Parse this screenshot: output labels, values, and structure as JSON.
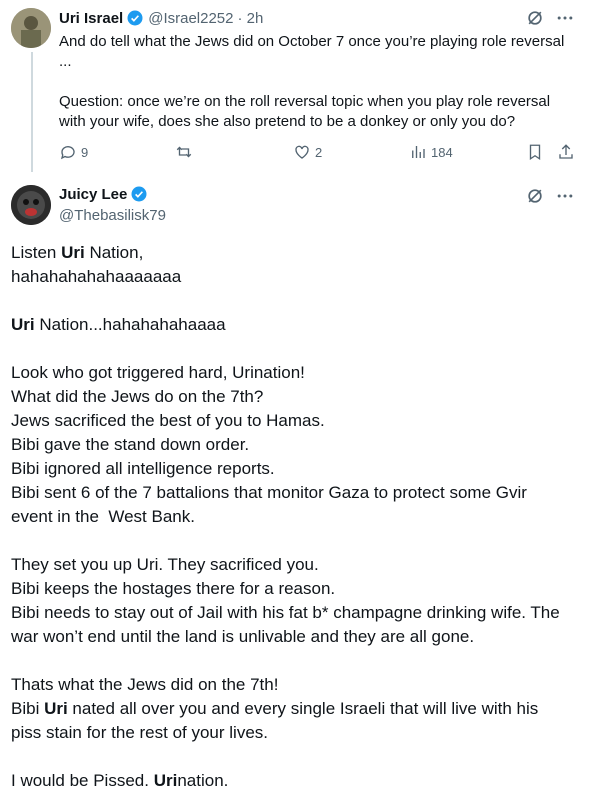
{
  "tweet1": {
    "name": "Uri Israel",
    "handle": "@Israel2252",
    "time": "· 2h",
    "text": "And do tell what the Jews did on October 7 once you’re playing role reversal\n...\n\nQuestion: once we’re on the roll reversal topic when you play role reversal with your wife, does she also pretend to be a donkey or only you do?",
    "replies": "9",
    "likes": "2",
    "views": "184"
  },
  "tweet2": {
    "name": "Juicy Lee",
    "handle": "@Thebasilisk79",
    "lines": [
      [
        "Listen ",
        "Uri",
        " Nation,"
      ],
      [
        "hahahahahahaaaaaaa",
        "",
        ""
      ],
      [
        "",
        "",
        ""
      ],
      [
        "",
        "Uri",
        " Nation...hahahahahaaaa"
      ],
      [
        "",
        "",
        ""
      ],
      [
        "Look who got triggered hard, Urination!",
        "",
        ""
      ],
      [
        "What did the Jews do on the 7th?",
        "",
        ""
      ],
      [
        "Jews sacrificed the best of you to Hamas.",
        "",
        ""
      ],
      [
        "Bibi gave the stand down order.",
        "",
        ""
      ],
      [
        "Bibi ignored all intelligence reports.",
        "",
        ""
      ],
      [
        "Bibi sent 6 of the 7 battalions that monitor Gaza to protect some Gvir",
        "",
        ""
      ],
      [
        "event in the  West Bank.",
        "",
        ""
      ],
      [
        "",
        "",
        ""
      ],
      [
        "They set you up Uri. They sacrificed you.",
        "",
        ""
      ],
      [
        "Bibi keeps the hostages there for a reason.",
        "",
        ""
      ],
      [
        "Bibi needs to stay out of Jail with his fat b* champagne drinking wife. The",
        "",
        ""
      ],
      [
        "war won’t end until the land is unlivable and they are all gone.",
        "",
        ""
      ],
      [
        "",
        "",
        ""
      ],
      [
        "Thats what the Jews did on the 7th!",
        "",
        ""
      ],
      [
        "Bibi ",
        "Uri",
        " nated all over you and every single Israeli that will live with his"
      ],
      [
        "piss stain for the rest of your lives.",
        "",
        ""
      ],
      [
        "",
        "",
        ""
      ],
      [
        "I would be Pissed. ",
        "Uri",
        "nation."
      ]
    ]
  },
  "colors": {
    "verified": "#1d9bf0",
    "muted": "#536471",
    "text": "#0f1419"
  },
  "icons": [
    "verified-icon",
    "grok-icon",
    "more-icon",
    "reply-icon",
    "retweet-icon",
    "like-icon",
    "views-icon",
    "bookmark-icon",
    "share-icon"
  ]
}
